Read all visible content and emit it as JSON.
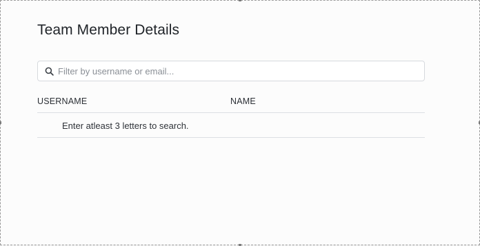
{
  "dialog": {
    "title": "Team Member Details"
  },
  "search": {
    "placeholder": "Filter by username or email...",
    "value": "",
    "icon": "search-icon"
  },
  "table": {
    "columns": [
      "USERNAME",
      "NAME"
    ],
    "empty_message": "Enter atleast 3 letters to search."
  }
}
